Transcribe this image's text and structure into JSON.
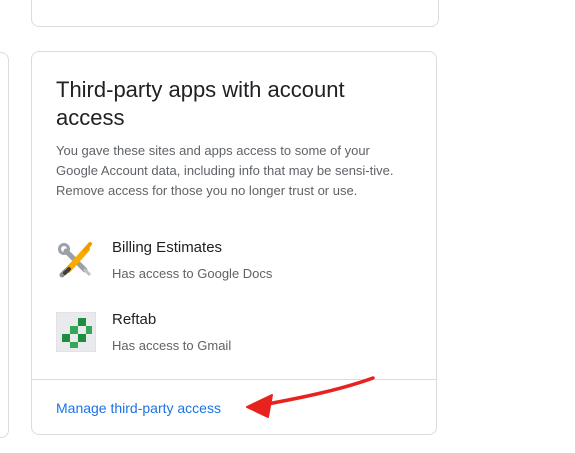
{
  "card": {
    "title": "Third-party apps with account access",
    "description": "You gave these sites and apps access to some of your Google Account data, including info that may be sensi-tive. Remove access for those you no longer trust or use.",
    "apps": [
      {
        "name": "Billing Estimates",
        "access": "Has access to Google Docs",
        "icon": "tools-icon"
      },
      {
        "name": "Reftab",
        "access": "Has access to Gmail",
        "icon": "reftab-logo-icon"
      }
    ],
    "manage_link": "Manage third-party access"
  },
  "annotation": {
    "arrow_color": "#e8231f"
  },
  "colors": {
    "link": "#1a73e8",
    "border": "#dadce0",
    "title": "#202124",
    "secondary_text": "#5f6368"
  }
}
